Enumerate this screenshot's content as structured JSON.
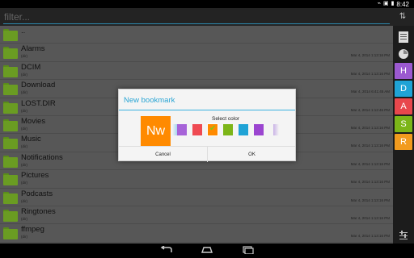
{
  "status_bar": {
    "icons": [
      "usb-icon",
      "android-icon",
      "notification-icon"
    ],
    "time": "8:42"
  },
  "filter": {
    "placeholder": "filter..."
  },
  "files": [
    {
      "name": "..",
      "dir": "",
      "date": ""
    },
    {
      "name": "Alarms",
      "dir": "(dir)",
      "date": "Mar 4, 2014 1:13:16 PM"
    },
    {
      "name": "DCIM",
      "dir": "(dir)",
      "date": "Mar 4, 2014 1:13:16 PM"
    },
    {
      "name": "Download",
      "dir": "(dir)",
      "date": "Mar 4, 2014 6:41:45 AM"
    },
    {
      "name": "LOST.DIR",
      "dir": "(dir)",
      "date": "Mar 4, 2014 1:12:46 PM"
    },
    {
      "name": "Movies",
      "dir": "(dir)",
      "date": "Mar 4, 2014 1:13:16 PM"
    },
    {
      "name": "Music",
      "dir": "(dir)",
      "date": "Mar 4, 2014 1:13:16 PM"
    },
    {
      "name": "Notifications",
      "dir": "(dir)",
      "date": "Mar 4, 2014 1:13:16 PM"
    },
    {
      "name": "Pictures",
      "dir": "(dir)",
      "date": "Mar 4, 2014 1:13:16 PM"
    },
    {
      "name": "Podcasts",
      "dir": "(dir)",
      "date": "Mar 4, 2014 1:13:16 PM"
    },
    {
      "name": "Ringtones",
      "dir": "(dir)",
      "date": "Mar 4, 2014 1:13:16 PM"
    },
    {
      "name": "ffmpeg",
      "dir": "(dir)",
      "date": "Mar 4, 2014 1:13:16 PM"
    }
  ],
  "sidebar": {
    "letters": [
      {
        "label": "H",
        "color": "#9b59d0"
      },
      {
        "label": "D",
        "color": "#1fa3d6"
      },
      {
        "label": "A",
        "color": "#e8474c"
      },
      {
        "label": "S",
        "color": "#7cb518"
      },
      {
        "label": "R",
        "color": "#f29b1e"
      }
    ]
  },
  "dialog": {
    "title": "New bookmark",
    "preview_text": "Nw",
    "preview_color": "#ff8a00",
    "select_label": "Select color",
    "swatches": [
      "#a663d8",
      "#ef4a52",
      "#ff8a00",
      "#7cb518",
      "#1fa3d6",
      "#9b45d0"
    ],
    "selected_swatch": 2,
    "cancel_label": "Cancel",
    "ok_label": "OK"
  }
}
